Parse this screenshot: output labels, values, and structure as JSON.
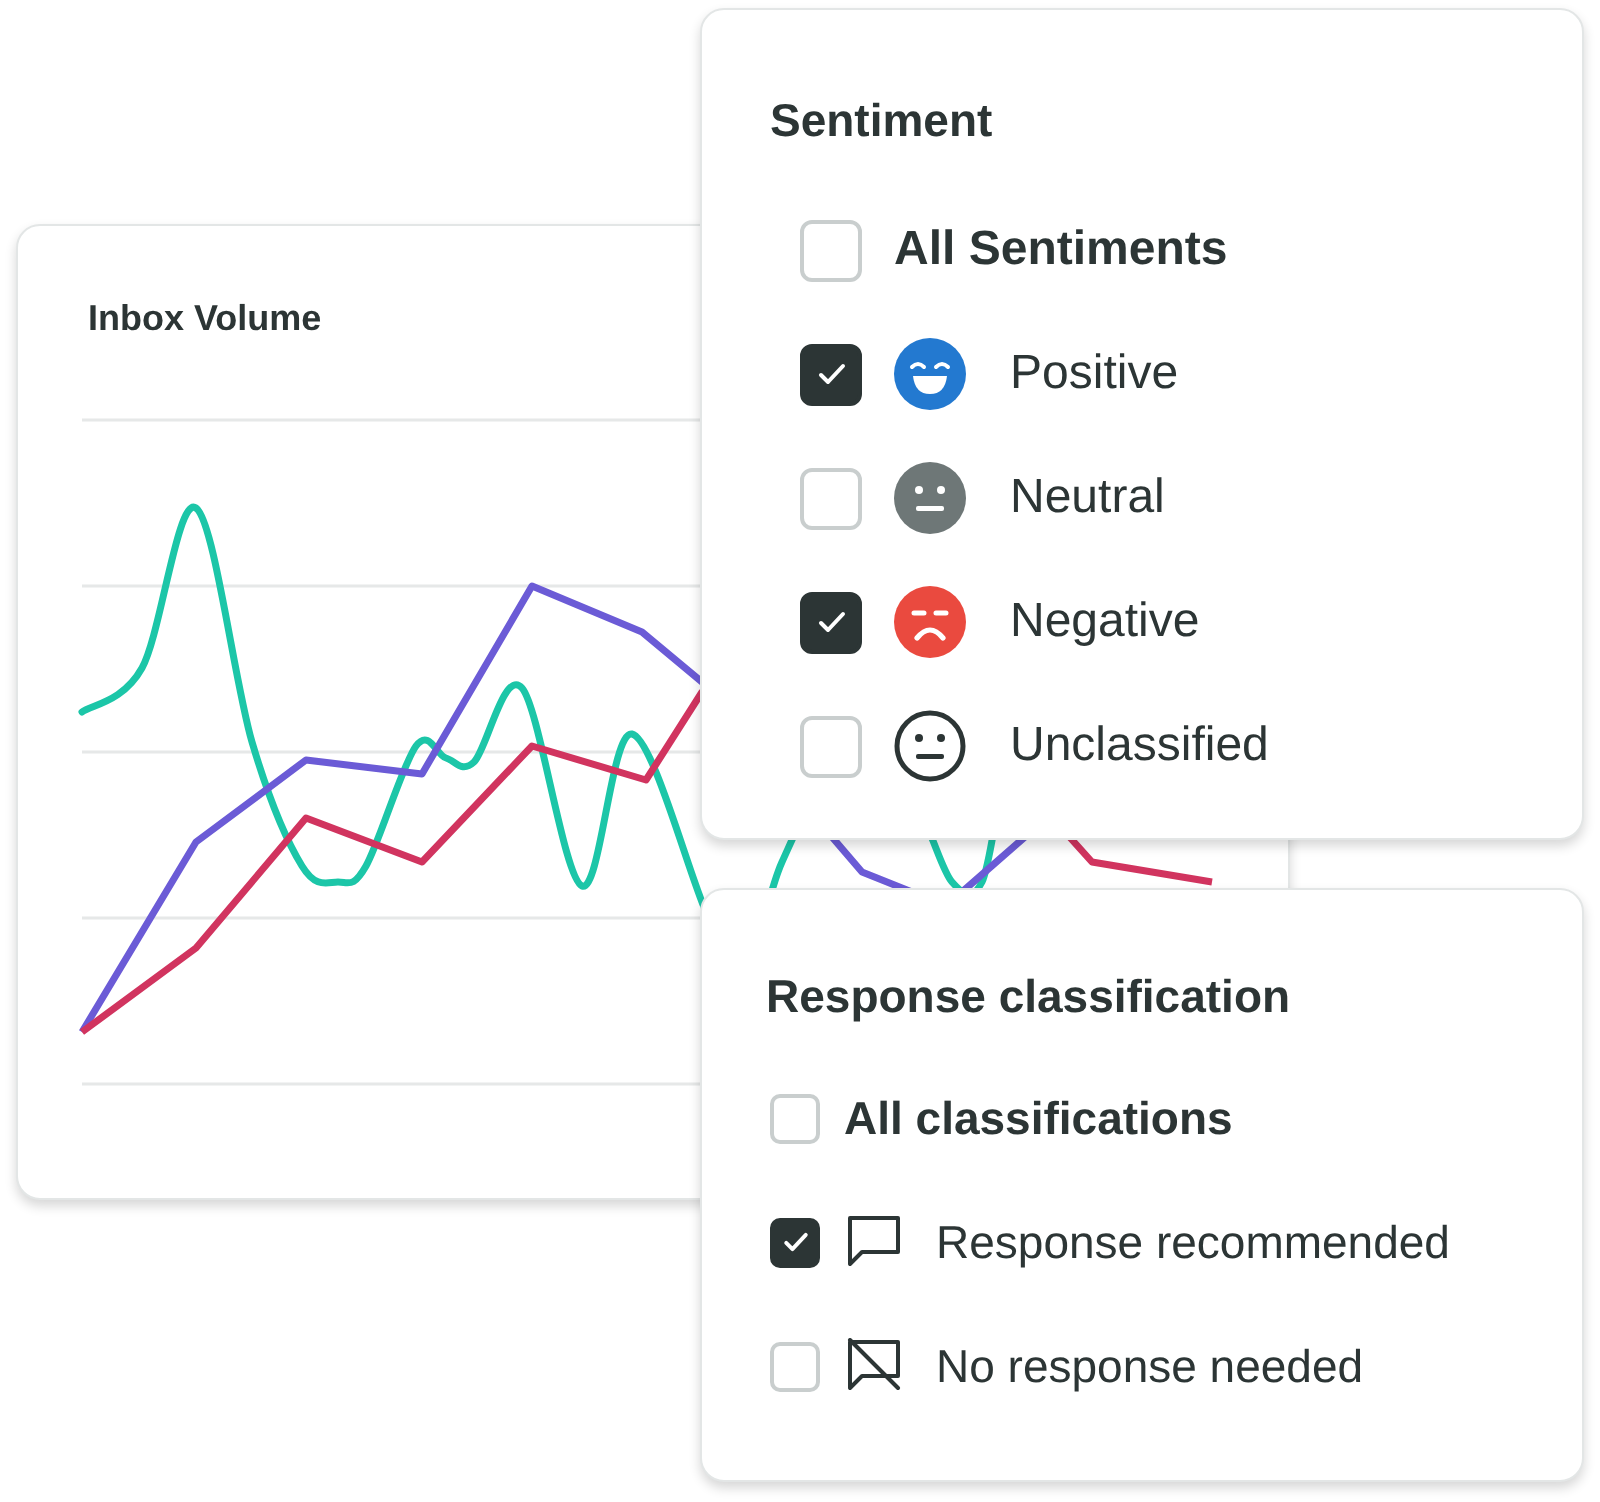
{
  "chart_card": {
    "title": "Inbox Volume"
  },
  "sentiment": {
    "title": "Sentiment",
    "options": [
      {
        "kind": "all",
        "label": "All Sentiments",
        "checked": false
      },
      {
        "kind": "positive",
        "label": "Positive",
        "checked": true
      },
      {
        "kind": "neutral",
        "label": "Neutral",
        "checked": false
      },
      {
        "kind": "negative",
        "label": "Negative",
        "checked": true
      },
      {
        "kind": "unclassified",
        "label": "Unclassified",
        "checked": false
      }
    ]
  },
  "response": {
    "title": "Response classification",
    "options": [
      {
        "kind": "all",
        "label": "All classifications",
        "checked": false
      },
      {
        "kind": "recommended",
        "label": "Response recommended",
        "checked": true
      },
      {
        "kind": "not_needed",
        "label": "No response needed",
        "checked": false
      }
    ]
  }
}
